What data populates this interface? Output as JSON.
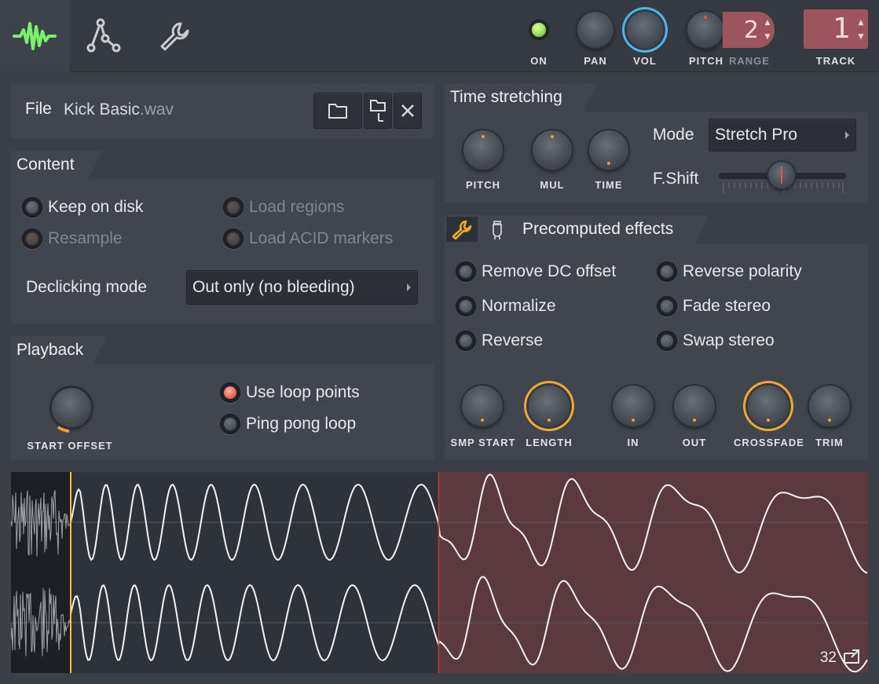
{
  "topbar": {
    "tabs": [
      {
        "icon": "waveform-icon",
        "active": true
      },
      {
        "icon": "envelope-icon",
        "active": false
      },
      {
        "icon": "wrench-icon",
        "active": false
      }
    ],
    "on_label": "ON",
    "pan_label": "PAN",
    "vol_label": "VOL",
    "pitch_label": "PITCH",
    "range_label": "RANGE",
    "range_value": "2",
    "track_label": "TRACK",
    "track_value": "1"
  },
  "file": {
    "label": "File",
    "name": "Kick Basic",
    "ext": ".wav",
    "buttons": [
      "open-folder-icon",
      "browse-file-icon",
      "close-icon"
    ]
  },
  "content": {
    "title": "Content",
    "options": [
      {
        "label": "Keep on disk",
        "enabled": true,
        "checked": false
      },
      {
        "label": "Load regions",
        "enabled": false,
        "checked": false
      },
      {
        "label": "Resample",
        "enabled": false,
        "checked": false
      },
      {
        "label": "Load ACID markers",
        "enabled": false,
        "checked": false
      }
    ],
    "declicking_label": "Declicking mode",
    "declicking_value": "Out only (no bleeding)"
  },
  "playback": {
    "title": "Playback",
    "start_offset_label": "START OFFSET",
    "options": [
      {
        "label": "Use loop points",
        "checked": true
      },
      {
        "label": "Ping pong loop",
        "checked": false
      }
    ]
  },
  "time_stretching": {
    "title": "Time stretching",
    "knobs": [
      "PITCH",
      "MUL",
      "TIME"
    ],
    "mode_label": "Mode",
    "mode_value": "Stretch Pro",
    "fshift_label": "F.Shift"
  },
  "precomputed": {
    "title": "Precomputed effects",
    "options": [
      {
        "label": "Remove DC offset",
        "checked": false
      },
      {
        "label": "Reverse polarity",
        "checked": false
      },
      {
        "label": "Normalize",
        "checked": false
      },
      {
        "label": "Fade stereo",
        "checked": false
      },
      {
        "label": "Reverse",
        "checked": false
      },
      {
        "label": "Swap stereo",
        "checked": false
      }
    ],
    "knobs": [
      "SMP START",
      "LENGTH",
      "IN",
      "OUT",
      "CROSSFADE",
      "TRIM"
    ]
  },
  "waveform": {
    "zoom_value": "32",
    "loop_region_color": "#5a3a3e",
    "start_marker_color": "#f0c040",
    "loop_marker_color": "#c03a3a"
  },
  "colors": {
    "accent_green": "#7df06a",
    "vol_ring": "#4ab8e8",
    "knob_ring_orange": "#f0a830",
    "range_box": "#9c555c"
  }
}
